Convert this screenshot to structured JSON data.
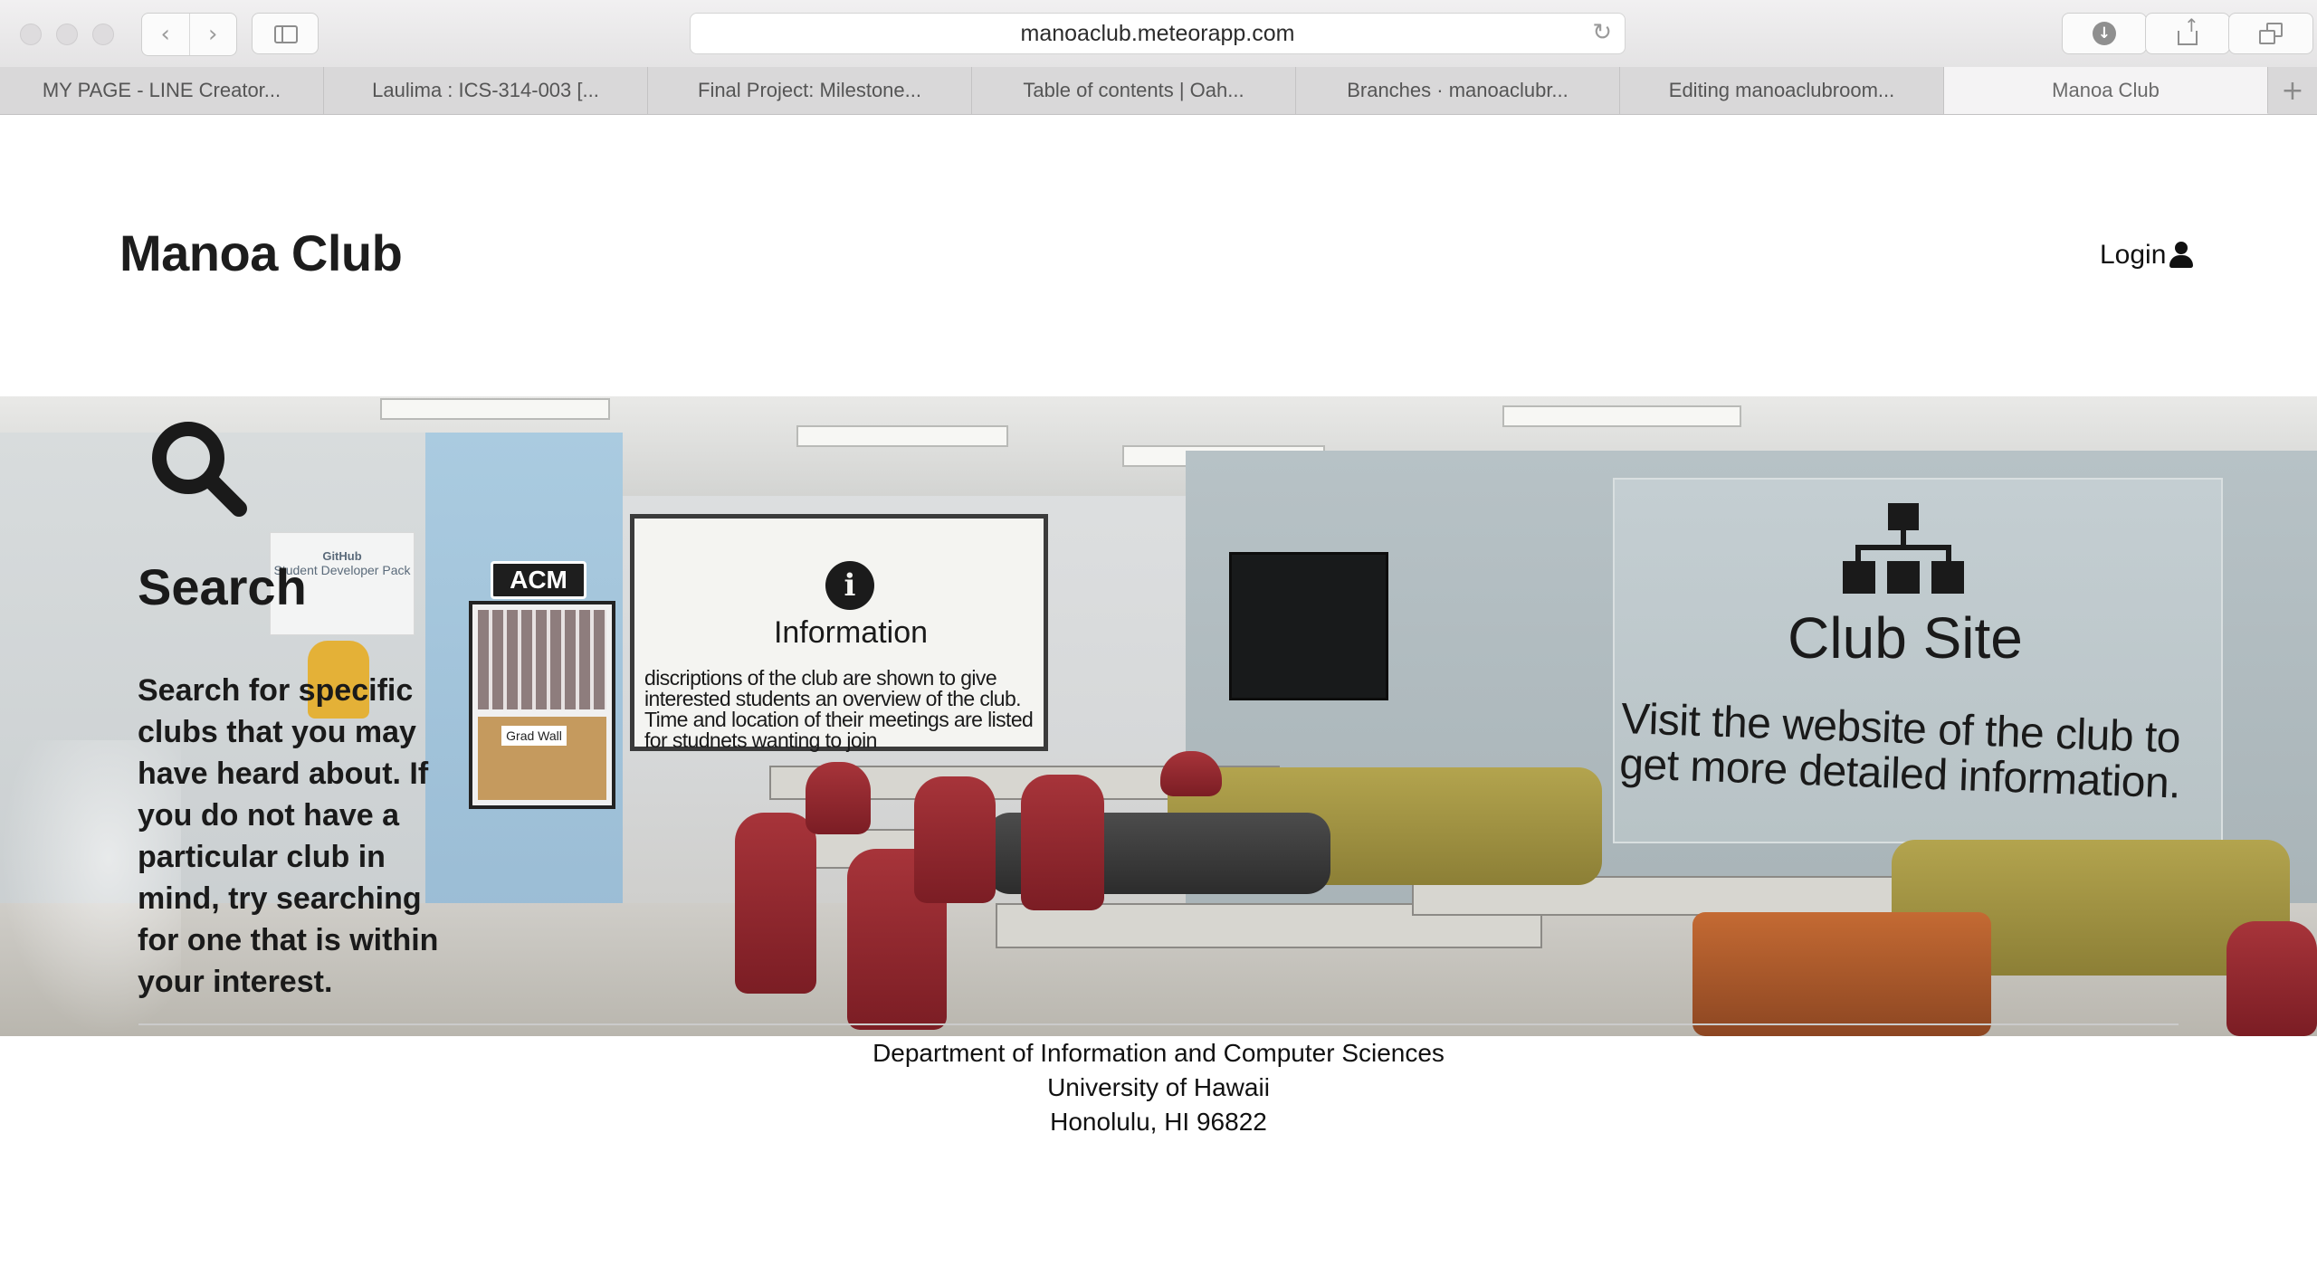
{
  "browser": {
    "url": "manoaclub.meteorapp.com",
    "tabs": [
      {
        "label": "MY PAGE - LINE Creator..."
      },
      {
        "label": "Laulima : ICS-314-003 [..."
      },
      {
        "label": "Final Project: Milestone..."
      },
      {
        "label": "Table of contents | Oah..."
      },
      {
        "label": "Branches · manoaclubr..."
      },
      {
        "label": "Editing manoaclubroom..."
      },
      {
        "label": "Manoa Club"
      }
    ],
    "active_tab": 6,
    "icons": [
      "back-icon",
      "forward-icon",
      "sidebar-icon",
      "reload-icon",
      "download-icon",
      "share-icon",
      "tabs-overview-icon",
      "new-tab-icon"
    ]
  },
  "navbar": {
    "site_title": "Manoa Club",
    "login_label": "Login",
    "login_icon": "user-icon"
  },
  "hero": {
    "search": {
      "icon": "search-icon",
      "title": "Search",
      "body": "Search for specific clubs that you may have heard about. If you do not have a particular club in mind, try searching for one that is within your interest."
    },
    "information": {
      "icon": "info-icon",
      "title": "Information",
      "body": "discriptions of the club are shown to give interested students an overview of the club. Time and location of their meetings are listed for studnets wanting to join"
    },
    "club_site": {
      "icon": "sitemap-icon",
      "title": "Club Site",
      "body": "Visit the website of the club to get more detailed information."
    },
    "photo_signage": {
      "acm": "ACM",
      "grad_wall": "Grad Wall",
      "github_poster_title": "GitHub",
      "github_poster_subtitle": "Student Developer Pack"
    }
  },
  "footer": {
    "lines": [
      "Department of Information and Computer Sciences",
      "University of Hawaii",
      "Honolulu, HI 96822"
    ]
  },
  "colors": {
    "chrome_bg": "#e4e3e4",
    "text_dark": "#1b1b1b",
    "acm_blue_wall": "#9fc1d8",
    "chair_red": "#8e2630",
    "sofa_olive": "#a39545"
  }
}
